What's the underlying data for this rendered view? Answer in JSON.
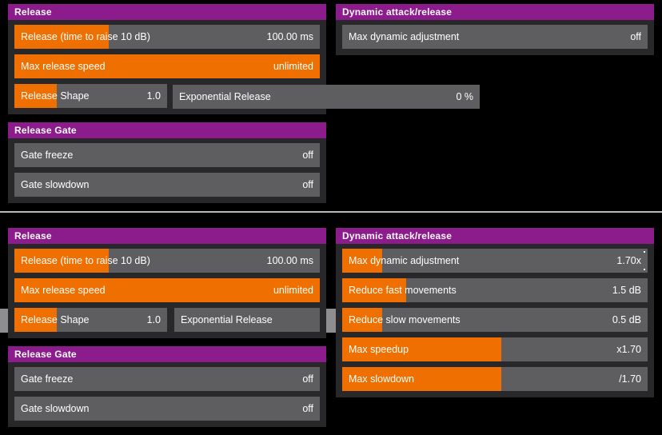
{
  "theme": {
    "background": "#000000",
    "panel_bg": "#28282a",
    "header_purple": "#8c1b8c",
    "row_gray": "#5e5e60",
    "fill_orange": "#ef7000",
    "hover_gray": "#8e8e90",
    "text": "#ffffff",
    "divider": "#b9b9b9"
  },
  "top": {
    "release_panel": {
      "title": "Release",
      "rows": [
        {
          "label": "Release (time to raise 10 dB)",
          "value": "100.00 ms",
          "fill_pct": 31
        },
        {
          "label": "Max release speed",
          "value": "unlimited",
          "fill_pct": 100
        },
        {
          "label": "Release Shape",
          "value": "1.0",
          "fill_pct": 28
        }
      ],
      "curve": {
        "label": "Exponential Release",
        "value": "0 %",
        "fill_pct": 0
      }
    },
    "dynamic_panel": {
      "title": "Dynamic attack/release",
      "rows": [
        {
          "label": "Max dynamic adjustment",
          "value": "off",
          "fill_pct": 0
        }
      ]
    },
    "gate_panel": {
      "title": "Release Gate",
      "rows": [
        {
          "label": "Gate freeze",
          "value": "off",
          "fill_pct": 0
        },
        {
          "label": "Gate slowdown",
          "value": "off",
          "fill_pct": 0
        }
      ]
    }
  },
  "bottom": {
    "release_panel": {
      "title": "Release",
      "rows": [
        {
          "label": "Release (time to raise 10 dB)",
          "value": "100.00 ms",
          "fill_pct": 31
        },
        {
          "label": "Max release speed",
          "value": "unlimited",
          "fill_pct": 100
        },
        {
          "label": "Release Shape",
          "value": "1.0",
          "fill_pct": 28
        }
      ],
      "curve": {
        "label": "Exponential Release",
        "value": "",
        "fill_pct": 0
      }
    },
    "dynamic_panel": {
      "title": "Dynamic attack/release",
      "rows": [
        {
          "label": "Max dynamic adjustment",
          "value": "1.70x",
          "fill_pct": 13
        },
        {
          "label": "Reduce fast movements",
          "value": "1.5 dB",
          "fill_pct": 21
        },
        {
          "label": "Reduce slow movements",
          "value": "0.5 dB",
          "fill_pct": 13
        },
        {
          "label": "Max speedup",
          "value": "x1.70",
          "fill_pct": 52
        },
        {
          "label": "Max slowdown",
          "value": "/1.70",
          "fill_pct": 52
        }
      ]
    },
    "gate_panel": {
      "title": "Release Gate",
      "rows": [
        {
          "label": "Gate freeze",
          "value": "off",
          "fill_pct": 0
        },
        {
          "label": "Gate slowdown",
          "value": "off",
          "fill_pct": 0
        }
      ]
    }
  }
}
